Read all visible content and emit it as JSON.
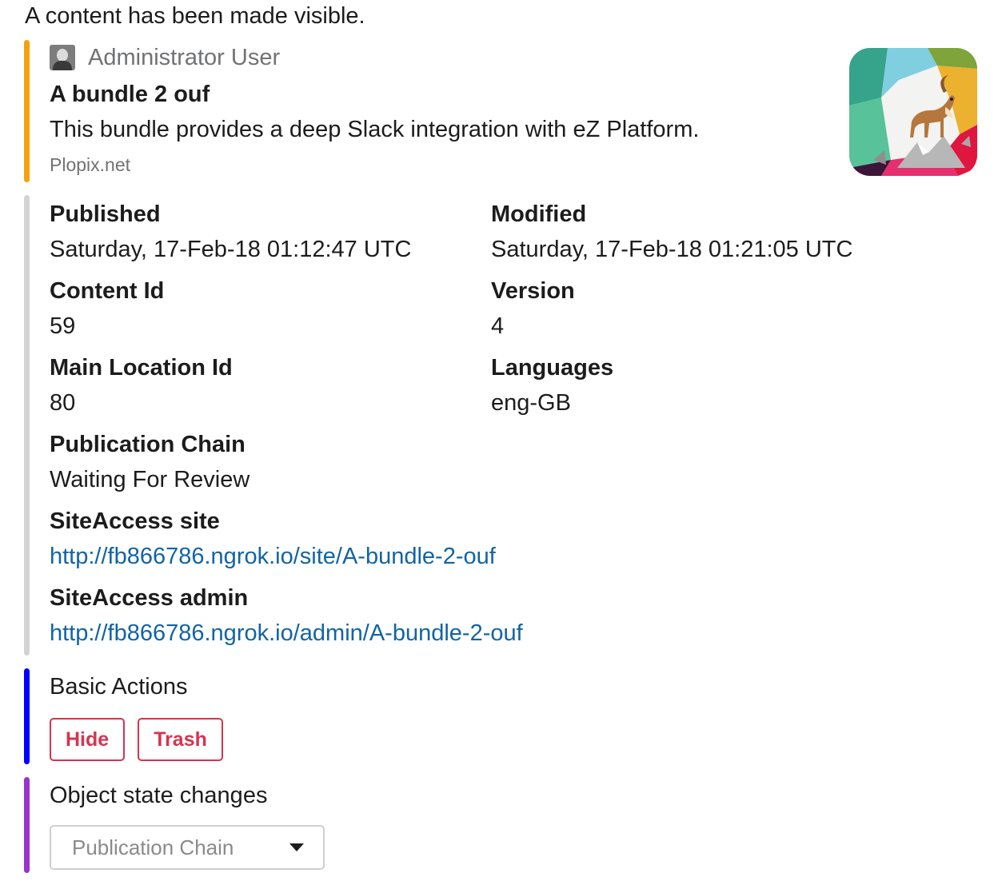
{
  "message": {
    "text": "A content has been made visible."
  },
  "attachment_main": {
    "accent_color": "#f7a00f",
    "author": "Administrator User",
    "author_icon": "avatar",
    "title": "A bundle 2 ouf",
    "text": "This bundle provides a deep Slack integration with eZ Platform.",
    "footer": "Plopix.net",
    "thumb_icon": "ibex-slack-logo-icon"
  },
  "attachment_fields": {
    "accent_color": "#d3d3d3",
    "published": {
      "title": "Published",
      "value": "Saturday, 17-Feb-18 01:12:47 UTC"
    },
    "modified": {
      "title": "Modified",
      "value": "Saturday, 17-Feb-18 01:21:05 UTC"
    },
    "content_id": {
      "title": "Content Id",
      "value": "59"
    },
    "version": {
      "title": "Version",
      "value": "4"
    },
    "main_location_id": {
      "title": "Main Location Id",
      "value": "80"
    },
    "languages": {
      "title": "Languages",
      "value": "eng-GB"
    },
    "publication_chain": {
      "title": "Publication Chain",
      "value": "Waiting For Review"
    },
    "siteaccess_site": {
      "title": "SiteAccess site",
      "value": "http://fb866786.ngrok.io/site/A-bundle-2-ouf"
    },
    "siteaccess_admin": {
      "title": "SiteAccess admin",
      "value": "http://fb866786.ngrok.io/admin/A-bundle-2-ouf"
    }
  },
  "attachment_actions": {
    "accent_color": "#0000ff",
    "text": "Basic Actions",
    "hide_label": "Hide",
    "trash_label": "Trash",
    "button_color": "#d6344f"
  },
  "attachment_state": {
    "accent_color": "#9933cc",
    "text": "Object state changes",
    "select_placeholder": "Publication Chain"
  }
}
